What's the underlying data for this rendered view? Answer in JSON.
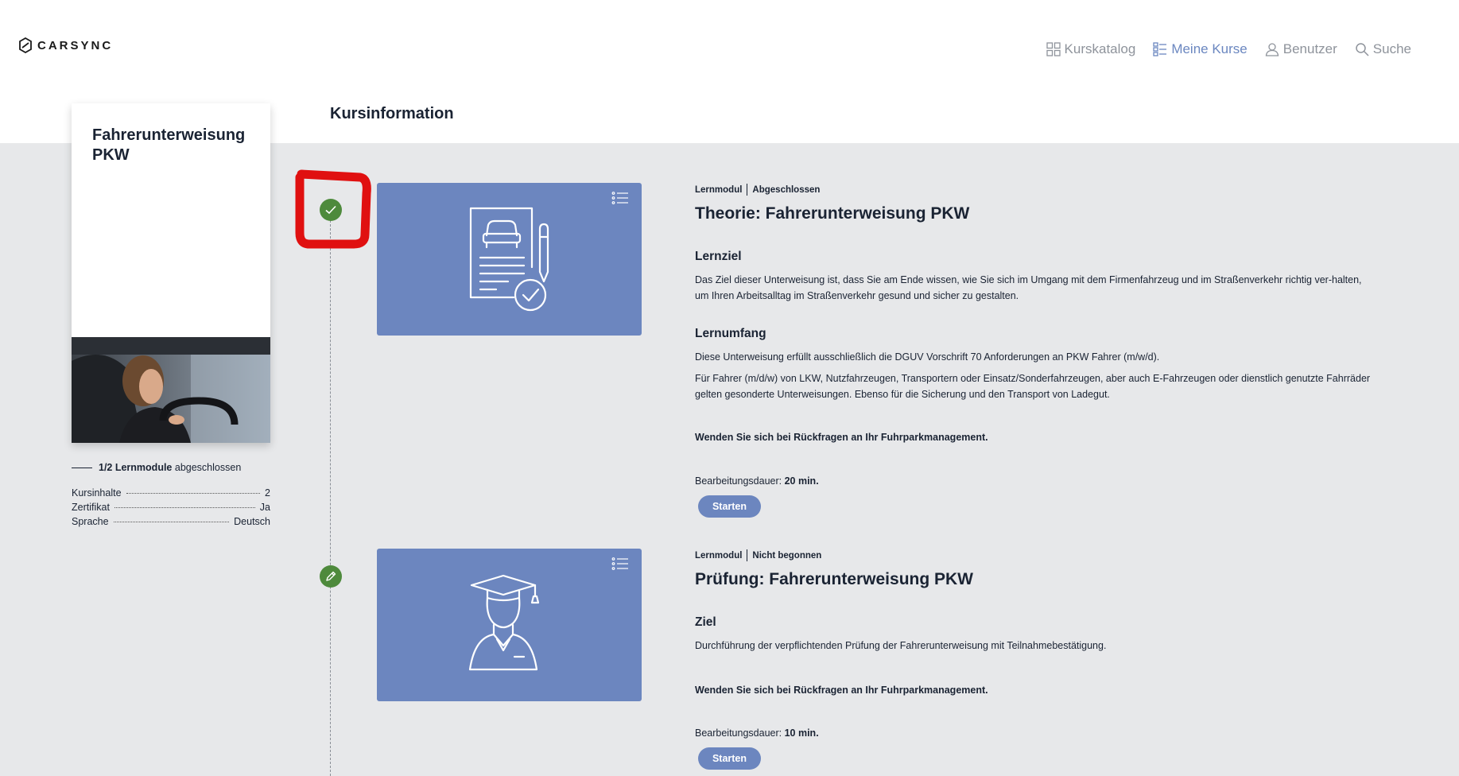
{
  "header": {
    "logo_text": "CARSYNC",
    "nav": [
      {
        "label": "Kurskatalog",
        "icon": "grid-icon"
      },
      {
        "label": "Meine Kurse",
        "icon": "list-icon"
      },
      {
        "label": "Benutzer",
        "icon": "user-icon"
      },
      {
        "label": "Suche",
        "icon": "search-icon"
      }
    ],
    "active_nav": "Meine Kurse",
    "page_title": "Kursinformation"
  },
  "course": {
    "title": "Fahrerunterweisung PKW",
    "progress_bold": "1/2 Lernmodule",
    "progress_rest": "abgeschlossen",
    "info": [
      {
        "label": "Kursinhalte",
        "value": "2"
      },
      {
        "label": "Zertifikat",
        "value": "Ja"
      },
      {
        "label": "Sprache",
        "value": "Deutsch"
      }
    ]
  },
  "modules": [
    {
      "type": "Lernmodul",
      "status": "Abgeschlossen",
      "status_icon": "check-icon",
      "title": "Theorie: Fahrerunterweisung PKW",
      "section1_heading": "Lernziel",
      "section1_text": "Das Ziel dieser Unterweisung ist, dass Sie am Ende wissen, wie Sie sich im Umgang mit dem Firmenfahrzeug und im Straßenverkehr richtig ver-halten, um Ihren Arbeitsalltag im Straßenverkehr gesund und sicher zu gestalten.",
      "section2_heading": "Lernumfang",
      "section2_text1": "Diese Unterweisung erfüllt ausschließlich die DGUV Vorschrift 70 Anforderungen an PKW Fahrer (m/w/d).",
      "section2_text2": "Für Fahrer (m/d/w) von LKW, Nutzfahrzeugen, Transportern oder Einsatz/Sonderfahrzeugen, aber auch E-Fahrzeugen oder dienstlich genutzte Fahrräder gelten gesonderte Unterweisungen. Ebenso für die Sicherung und den Transport von Ladegut.",
      "note": "Wenden Sie sich bei Rückfragen an Ihr Fuhrparkmanagement.",
      "duration_label": "Bearbeitungsdauer:",
      "duration_value": "20 min.",
      "button": "Starten"
    },
    {
      "type": "Lernmodul",
      "status": "Nicht begonnen",
      "status_icon": "pencil-icon",
      "title": "Prüfung: Fahrerunterweisung PKW",
      "section1_heading": "Ziel",
      "section1_text": "Durchführung der verpflichtenden Prüfung der Fahrerunterweisung mit Teilnahmebestätigung.",
      "note": "Wenden Sie sich bei Rückfragen an Ihr Fuhrparkmanagement.",
      "duration_label": "Bearbeitungsdauer:",
      "duration_value": "10 min.",
      "button": "Starten"
    }
  ],
  "colors": {
    "accent": "#6c86bf",
    "status_green": "#4e8a3c",
    "background": "#e7e8ea",
    "annotation_red": "#e01010"
  }
}
